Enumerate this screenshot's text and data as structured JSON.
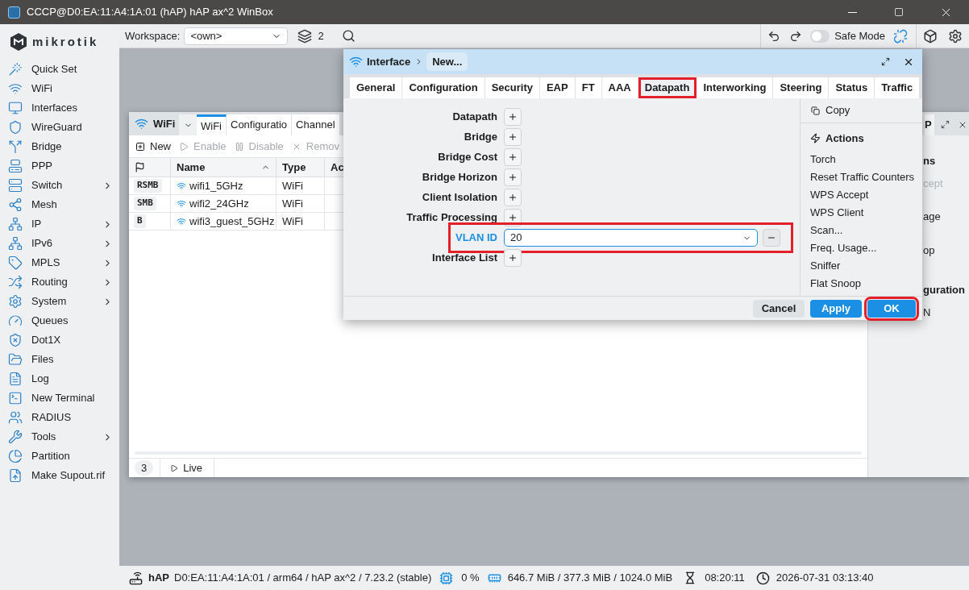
{
  "window": {
    "title": "CCCP@D0:EA:11:A4:1A:01 (hAP) hAP ax^2 WinBox"
  },
  "sidebar": {
    "logo": "mikrotik",
    "items": [
      {
        "label": "Quick Set",
        "has_submenu": false
      },
      {
        "label": "WiFi",
        "has_submenu": false
      },
      {
        "label": "Interfaces",
        "has_submenu": false
      },
      {
        "label": "WireGuard",
        "has_submenu": false
      },
      {
        "label": "Bridge",
        "has_submenu": false
      },
      {
        "label": "PPP",
        "has_submenu": false
      },
      {
        "label": "Switch",
        "has_submenu": true
      },
      {
        "label": "Mesh",
        "has_submenu": false
      },
      {
        "label": "IP",
        "has_submenu": true
      },
      {
        "label": "IPv6",
        "has_submenu": true
      },
      {
        "label": "MPLS",
        "has_submenu": true
      },
      {
        "label": "Routing",
        "has_submenu": true
      },
      {
        "label": "System",
        "has_submenu": true
      },
      {
        "label": "Queues",
        "has_submenu": false
      },
      {
        "label": "Dot1X",
        "has_submenu": false
      },
      {
        "label": "Files",
        "has_submenu": false
      },
      {
        "label": "Log",
        "has_submenu": false
      },
      {
        "label": "New Terminal",
        "has_submenu": false
      },
      {
        "label": "RADIUS",
        "has_submenu": false
      },
      {
        "label": "Tools",
        "has_submenu": true
      },
      {
        "label": "Partition",
        "has_submenu": false
      },
      {
        "label": "Make Supout.rif",
        "has_submenu": false
      }
    ]
  },
  "toolbar": {
    "workspace_label": "Workspace:",
    "workspace_value": "<own>",
    "window_count": "2",
    "safe_mode_label": "Safe Mode",
    "safe_mode_on": false
  },
  "wifi_window": {
    "title": "WiFi",
    "tabs": [
      {
        "label": "WiFi",
        "selected": true
      },
      {
        "label": "Configuratio",
        "selected": false
      },
      {
        "label": "Channel",
        "selected": false
      }
    ],
    "right_tab": "P",
    "actions": [
      {
        "label": "New",
        "disabled": false
      },
      {
        "label": "Enable",
        "disabled": true
      },
      {
        "label": "Disable",
        "disabled": true
      },
      {
        "label": "Remov",
        "disabled": true
      }
    ],
    "columns": [
      "Name",
      "Type",
      "Ac"
    ],
    "rows": [
      {
        "flags": "RSMB",
        "name": "wifi1_5GHz",
        "type": "WiFi"
      },
      {
        "flags": "SMB",
        "name": "wifi2_24GHz",
        "type": "WiFi"
      },
      {
        "flags": "B",
        "name": "wifi3_guest_5GHz",
        "type": "WiFi"
      }
    ],
    "count": "3",
    "live": "Live",
    "side_fragments": [
      {
        "text": "ns",
        "kind": "heading",
        "disabled": false
      },
      {
        "text": "cept",
        "kind": "item",
        "disabled": true
      },
      {
        "text": "age",
        "kind": "item",
        "disabled": false
      },
      {
        "text": "op",
        "kind": "item",
        "disabled": false
      },
      {
        "text": "guration",
        "kind": "heading",
        "disabled": false
      },
      {
        "text": "N",
        "kind": "item",
        "disabled": false
      }
    ]
  },
  "dialog": {
    "title": "Interface",
    "breadcrumb": "New...",
    "tabs": [
      {
        "label": "General",
        "selected": false,
        "highlighted": false
      },
      {
        "label": "Configuration",
        "selected": false,
        "highlighted": false
      },
      {
        "label": "Security",
        "selected": false,
        "highlighted": false
      },
      {
        "label": "EAP",
        "selected": false,
        "highlighted": false
      },
      {
        "label": "FT",
        "selected": false,
        "highlighted": false
      },
      {
        "label": "AAA",
        "selected": false,
        "highlighted": false
      },
      {
        "label": "Datapath",
        "selected": true,
        "highlighted": true
      },
      {
        "label": "Interworking",
        "selected": false,
        "highlighted": false
      },
      {
        "label": "Steering",
        "selected": false,
        "highlighted": false
      },
      {
        "label": "Status",
        "selected": false,
        "highlighted": false
      },
      {
        "label": "Traffic",
        "selected": false,
        "highlighted": false
      }
    ],
    "fields": [
      {
        "label": "Datapath",
        "kind": "add",
        "highlighted": false
      },
      {
        "label": "Bridge",
        "kind": "add",
        "highlighted": false
      },
      {
        "label": "Bridge Cost",
        "kind": "add",
        "highlighted": false
      },
      {
        "label": "Bridge Horizon",
        "kind": "add",
        "highlighted": false
      },
      {
        "label": "Client Isolation",
        "kind": "add",
        "highlighted": false
      },
      {
        "label": "Traffic Processing",
        "kind": "add",
        "highlighted": false
      },
      {
        "label": "VLAN ID",
        "kind": "combo",
        "value": "20",
        "highlighted": true
      },
      {
        "label": "Interface List",
        "kind": "add",
        "highlighted": false
      }
    ],
    "copy": "Copy",
    "actions_heading": "Actions",
    "actions": [
      "Torch",
      "Reset Traffic Counters",
      "WPS Accept",
      "WPS Client",
      "Scan...",
      "Freq. Usage...",
      "Sniffer",
      "Flat Snoop"
    ],
    "buttons": [
      {
        "label": "Cancel",
        "kind": "secondary",
        "highlighted": false
      },
      {
        "label": "Apply",
        "kind": "primary",
        "highlighted": false
      },
      {
        "label": "OK",
        "kind": "primary",
        "highlighted": true
      }
    ]
  },
  "status_bar": {
    "device": "hAP",
    "info": "D0:EA:11:A4:1A:01 / arm64 / hAP ax^2 / 7.23.2 (stable)",
    "cpu": "0 %",
    "memory": "646.7 MiB / 377.3 MiB / 1024.0 MiB",
    "uptime": "08:20:11",
    "clock": "2026-07-31 03:13:40"
  }
}
